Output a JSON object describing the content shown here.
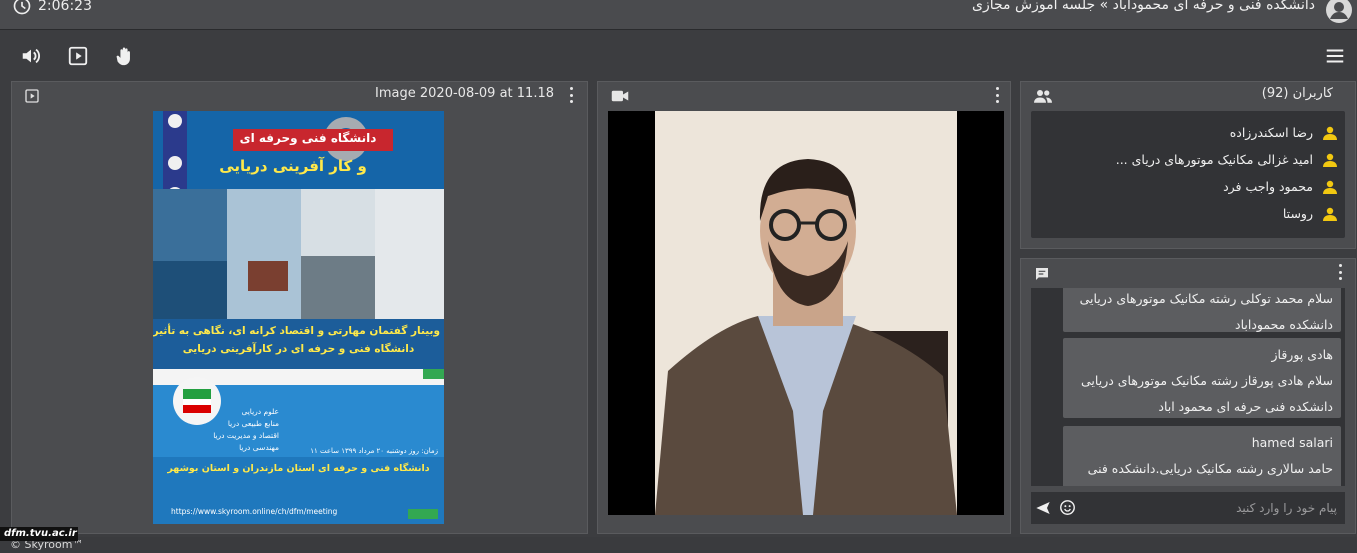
{
  "header": {
    "timer": "2:06:23",
    "title": "دانشکده فنی و حرفه ای محمودآباد » جلسه آموزش مجازی"
  },
  "toolbar": {
    "icons": [
      "speaker-icon",
      "play-presentation-icon",
      "raise-hand-icon",
      "menu-icon"
    ]
  },
  "presentation": {
    "title": "Image 2020-08-09 at 11.18",
    "poster_text": {
      "heading_1": "دانشگاه فنی وحرفه ای",
      "heading_2": "و کار آفرینی دریایی",
      "webinar_1": "وبینار گفتمان مهارتی و اقتصاد کرانه ای، نگاهی به تأثیر",
      "webinar_2": "دانشگاه فنی و حرفه ای در کارآفرینی دریایی",
      "list": [
        "علوم دریایی",
        "منابع طبیعی دریا",
        "اقتصاد و مدیریت دریا",
        "مهندسی دریا"
      ],
      "date": "زمان: روز دوشنبه ۲۰ مرداد ۱۳۹۹ ساعت ۱۱",
      "organizer": "دانشگاه فنی و حرفه ای استان مازندران و استان بوشهر",
      "url": "https://www.skyroom.online/ch/dfm/meeting"
    }
  },
  "users": {
    "title": "کاربران (92)",
    "list": [
      "رضا اسکندرزاده",
      "امید غزالی مکانیک موتورهای دریای ...",
      "محمود واجب فرد",
      "روستا"
    ]
  },
  "chat": {
    "messages": [
      {
        "name": "",
        "text": "سلام محمد توکلی رشته مکانیک موتورهای دریایی دانشکده محموداباد"
      },
      {
        "name": "هادی پورقاز",
        "text": "سلام هادی پورقاز رشته مکانیک موتورهای دریایی دانشکده فنی حرفه ای محمود اباد"
      },
      {
        "name": "hamed salari",
        "text": "حامد سالاری رشته مکانیک دریایی.دانشکده فنی"
      }
    ],
    "placeholder": "پیام خود را وارد کنید"
  },
  "footer": {
    "brand": "© Skyroom™",
    "watermark": "dfm.tvu.ac.ir"
  },
  "colors": {
    "background": "#3c3d40",
    "panel": "#4b4c4f",
    "user_icon": "#f2c811",
    "poster_blue": "#1e74b8",
    "poster_red": "#c8262e"
  }
}
